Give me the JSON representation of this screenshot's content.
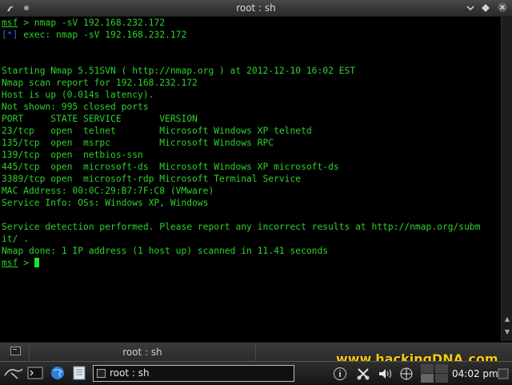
{
  "window": {
    "title": "root : sh"
  },
  "terminal": {
    "lines": [
      [
        {
          "text": "msf",
          "style": "ul"
        },
        {
          "text": " > nmap -sV 192.168.232.172"
        }
      ],
      [
        {
          "text": "[*]",
          "style": "blue"
        },
        {
          "text": " exec: nmap -sV 192.168.232.172"
        }
      ],
      [],
      [],
      [
        {
          "text": "Starting Nmap 5.51SVN ( http://nmap.org ) at 2012-12-10 16:02 EST"
        }
      ],
      [
        {
          "text": "Nmap scan report for 192.168.232.172"
        }
      ],
      [
        {
          "text": "Host is up (0.014s latency)."
        }
      ],
      [
        {
          "text": "Not shown: 995 closed ports"
        }
      ],
      [
        {
          "text": "PORT     STATE SERVICE       VERSION"
        }
      ],
      [
        {
          "text": "23/tcp   open  telnet        Microsoft Windows XP telnetd"
        }
      ],
      [
        {
          "text": "135/tcp  open  msrpc         Microsoft Windows RPC"
        }
      ],
      [
        {
          "text": "139/tcp  open  netbios-ssn"
        }
      ],
      [
        {
          "text": "445/tcp  open  microsoft-ds  Microsoft Windows XP microsoft-ds"
        }
      ],
      [
        {
          "text": "3389/tcp open  microsoft-rdp Microsoft Terminal Service"
        }
      ],
      [
        {
          "text": "MAC Address: 00:0C:29:B7:7F:C8 (VMware)"
        }
      ],
      [
        {
          "text": "Service Info: OSs: Windows XP, Windows"
        }
      ],
      [],
      [
        {
          "text": "Service detection performed. Please report any incorrect results at http://nmap.org/subm"
        }
      ],
      [
        {
          "text": "it/ ."
        }
      ],
      [
        {
          "text": "Nmap done: 1 IP address (1 host up) scanned in 11.41 seconds"
        }
      ],
      [
        {
          "text": "msf",
          "style": "ul"
        },
        {
          "text": " > "
        },
        {
          "cursor": true
        }
      ]
    ],
    "text_color": "#2ed12e",
    "prompt_marker_color": "#3a5cff"
  },
  "tabbar": {
    "tab_label": "root : sh"
  },
  "taskbar": {
    "task_label": "root : sh",
    "clock": "04:02 pm",
    "icons": [
      "kali-dragon-icon",
      "terminal-icon",
      "browser-globe-icon",
      "text-editor-icon"
    ],
    "tray_icons": [
      "info-icon",
      "tools-icon",
      "volume-icon",
      "network-icon"
    ]
  },
  "watermark": {
    "text": "www.hackingDNA.com",
    "color": "#f2cc10"
  }
}
